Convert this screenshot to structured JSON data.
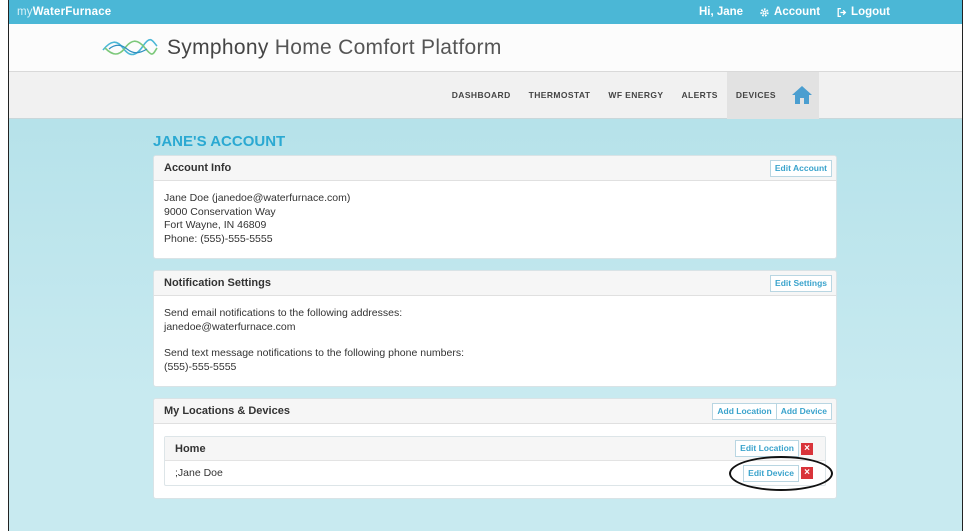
{
  "topbar": {
    "brand_prefix": "my",
    "brand_name": "WaterFurnace",
    "greeting": "Hi, Jane",
    "account_label": "Account",
    "logout_label": "Logout"
  },
  "header": {
    "logo_bold": "Symphony",
    "logo_rest": " Home Comfort Platform"
  },
  "nav": {
    "items": [
      "DASHBOARD",
      "THERMOSTAT",
      "WF ENERGY",
      "ALERTS",
      "DEVICES"
    ]
  },
  "page": {
    "title": "JANE'S ACCOUNT"
  },
  "account_info": {
    "title": "Account Info",
    "edit_label": "Edit Account",
    "lines": [
      "Jane Doe (janedoe@waterfurnace.com)",
      "9000 Conservation Way",
      "Fort Wayne, IN 46809",
      "Phone: (555)-555-5555"
    ]
  },
  "notifications": {
    "title": "Notification Settings",
    "edit_label": "Edit Settings",
    "email_intro": "Send email notifications to the following addresses:",
    "email": "janedoe@waterfurnace.com",
    "sms_intro": "Send text message notifications to the following phone numbers:",
    "phone": "(555)-555-5555"
  },
  "locations": {
    "title": "My Locations & Devices",
    "add_location_label": "Add Location",
    "add_device_label": "Add Device",
    "location": {
      "name": "Home",
      "edit_label": "Edit Location",
      "delete_glyph": "×",
      "device": {
        "name": ";Jane Doe",
        "edit_label": "Edit Device",
        "delete_glyph": "×"
      }
    }
  },
  "colors": {
    "topbar": "#4bb7d6",
    "accent": "#2ba9d2",
    "delete": "#d9343a",
    "home_icon": "#4a9ed0"
  }
}
